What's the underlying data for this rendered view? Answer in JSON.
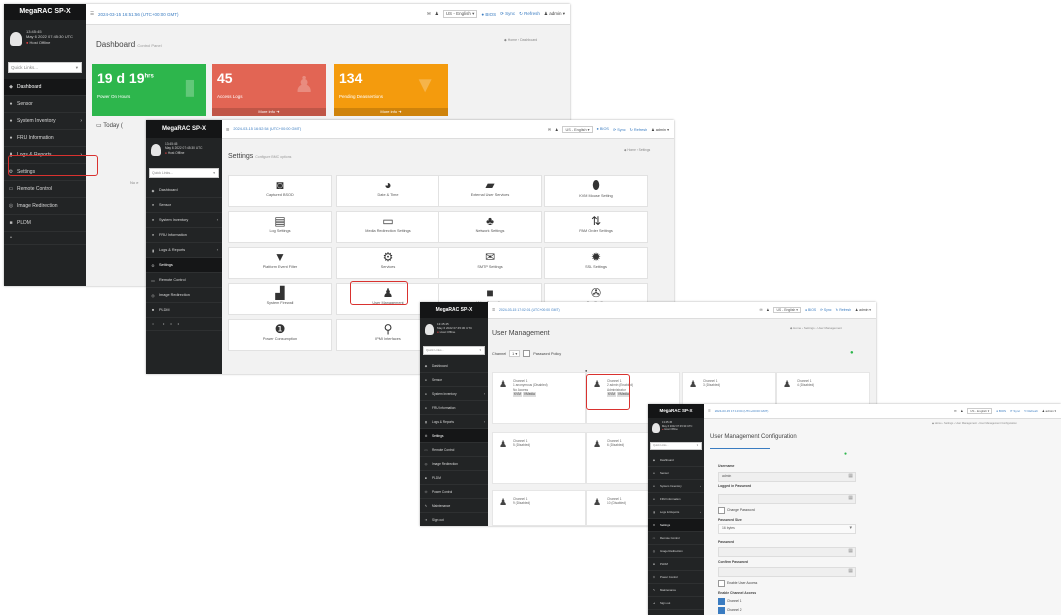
{
  "common": {
    "brand": "MegaRAC SP-X",
    "user_time": "13:45:45",
    "user_date": "May 6 2022 07:45:30 UTC",
    "user_status": "Host Offline",
    "quick_links": "Quick Links...",
    "lang": "US - English",
    "bios": "BIOS",
    "sync": "Sync",
    "refresh": "Refresh",
    "admin": "admin",
    "home": "Home",
    "hamburger_icon": "hamburger-icon",
    "colors": {
      "sidebar": "#222425",
      "link": "#3a7cc1",
      "highlight": "#d9322f",
      "green": "#2db64c",
      "salmon": "#e26554",
      "orange": "#f49b0d"
    }
  },
  "w1": {
    "timestamp": "2024-03-15 16:51:56 (UTC+00:00 GMT)",
    "page_title": "Dashboard",
    "page_sub": "Control Panel",
    "crumb": "Home › Dashboard",
    "menu": [
      "Dashboard",
      "Sensor",
      "System Inventory",
      "FRU Information",
      "Logs & Reports",
      "Settings",
      "Remote Control",
      "Image Redirection",
      "PLDM"
    ],
    "card1_value": "19 d 19",
    "card1_unit": "hrs",
    "card1_label": "Power On Hours",
    "card2_value": "45",
    "card2_label": "Access Logs",
    "card2_more": "More info",
    "card3_value": "134",
    "card3_label": "Pending Deassertions",
    "card3_more": "More info",
    "today_label": "Today (",
    "no_label": "No e"
  },
  "w2": {
    "timestamp": "2024-03-15 16:52:54 (UTC+00:00 GMT)",
    "page_title": "Settings",
    "page_sub": "Configure BMC options",
    "crumb": "Home › Settings",
    "menu": [
      "Dashboard",
      "Sensor",
      "System Inventory",
      "FRU Information",
      "Logs & Reports",
      "Settings",
      "Remote Control",
      "Image Redirection",
      "PLDM"
    ],
    "tiles": [
      "Captured BSOD",
      "Date & Time",
      "External User Services",
      "KVM Mouse Setting",
      "Log Settings",
      "Media Redirection Settings",
      "Network Settings",
      "PAM Order Settings",
      "Platform Event Filter",
      "Services",
      "SMTP Settings",
      "SSL Settings",
      "System Firewall",
      "User Management",
      "Video Recording",
      "Fan Profile",
      "Power Consumption",
      "IPMI Interfaces"
    ]
  },
  "w3": {
    "timestamp": "2024-03-15 17:02:01 (UTC+00:00 GMT)",
    "page_title": "User Management",
    "crumb": "Home › Settings › User Management",
    "channel_label": "Channel",
    "channel_value": "1",
    "password_policy": "Password Policy",
    "menu": [
      "Dashboard",
      "Sensor",
      "System Inventory",
      "FRU Information",
      "Logs & Reports",
      "Settings",
      "Remote Control",
      "Image Redirection",
      "PLDM",
      "Power Control",
      "Maintenance",
      "Sign out"
    ],
    "users": [
      {
        "l1": "Channel 1",
        "l2": "1 anonymous (Disabled)",
        "l3": "No Access",
        "tags": [
          "KVM",
          "VMedia"
        ]
      },
      {
        "l1": "Channel 1",
        "l2": "2 admin (Enabled)",
        "l3": "Administrator",
        "tags": [
          "KVM",
          "VMedia"
        ]
      },
      {
        "l1": "Channel 1",
        "l2": "3 (Disabled)",
        "l3": "",
        "tags": []
      },
      {
        "l1": "Channel 1",
        "l2": "4 (Disabled)",
        "l3": "",
        "tags": []
      },
      {
        "l1": "Channel 1",
        "l2": "5 (Disabled)",
        "l3": "",
        "tags": []
      },
      {
        "l1": "Channel 1",
        "l2": "6 (Disabled)",
        "l3": "",
        "tags": []
      },
      {
        "l1": "Channel 1",
        "l2": "9 (Disabled)",
        "l3": "",
        "tags": []
      },
      {
        "l1": "Channel 1",
        "l2": "10 (Disabled)",
        "l3": "",
        "tags": []
      }
    ]
  },
  "w4": {
    "timestamp": "2024-03-15 17:13:04 (UTC+00:00 GMT)",
    "page_title": "User Management Configuration",
    "crumb": "Home › Settings › User Management › User Management Configuration",
    "menu": [
      "Dashboard",
      "Sensor",
      "System Inventory",
      "FRU Information",
      "Logs & Reports",
      "Settings",
      "Remote Control",
      "Image Redirection",
      "PLDM",
      "Power Control",
      "Maintenance",
      "Sign out"
    ],
    "username_label": "Username",
    "username_value": "admin",
    "logged_pw_label": "Logged in Password",
    "change_pw_label": "Change Password",
    "pw_size_label": "Password Size",
    "pw_size_value": "16 bytes",
    "password_label": "Password",
    "confirm_label": "Confirm Password",
    "enable_access_label": "Enable User Access",
    "enable_channel_label": "Enable Channel Access",
    "channel1_label": "Channel 1",
    "channel2_label": "Channel 2"
  }
}
